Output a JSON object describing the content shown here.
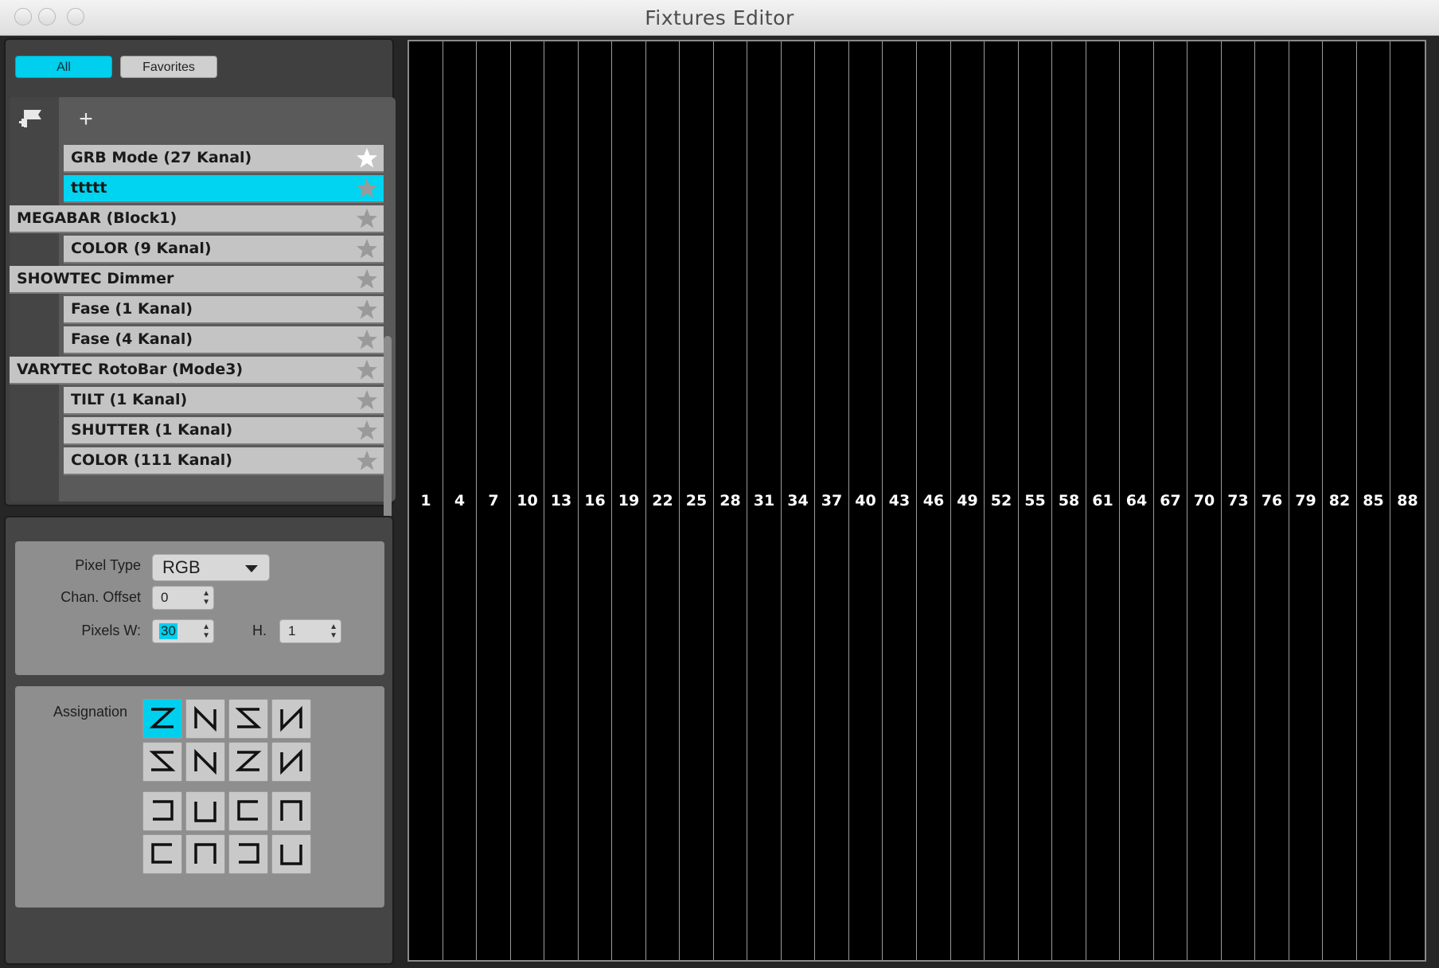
{
  "window": {
    "title": "Fixtures Editor"
  },
  "filters": {
    "all_label": "All",
    "favorites_label": "Favorites"
  },
  "fixtures": [
    {
      "label": "GRB Mode (27 Kanal)",
      "level": 1,
      "selected": false,
      "star": "bright"
    },
    {
      "label": "ttttt",
      "level": 1,
      "selected": true,
      "star": "dim"
    },
    {
      "label": "MEGABAR (Block1)",
      "level": 0,
      "selected": false,
      "star": "dim"
    },
    {
      "label": "COLOR (9 Kanal)",
      "level": 1,
      "selected": false,
      "star": "dim"
    },
    {
      "label": "SHOWTEC Dimmer",
      "level": 0,
      "selected": false,
      "star": "dim"
    },
    {
      "label": "Fase (1 Kanal)",
      "level": 1,
      "selected": false,
      "star": "dim"
    },
    {
      "label": "Fase (4 Kanal)",
      "level": 1,
      "selected": false,
      "star": "dim"
    },
    {
      "label": "VARYTEC RotoBar (Mode3)",
      "level": 0,
      "selected": false,
      "star": "dim"
    },
    {
      "label": "TILT (1 Kanal)",
      "level": 1,
      "selected": false,
      "star": "dim"
    },
    {
      "label": "SHUTTER (1 Kanal)",
      "level": 1,
      "selected": false,
      "star": "dim"
    },
    {
      "label": "COLOR (111 Kanal)",
      "level": 1,
      "selected": false,
      "star": "dim"
    }
  ],
  "properties": {
    "pixel_type_label": "Pixel Type",
    "pixel_type_value": "RGB",
    "chan_offset_label": "Chan. Offset",
    "chan_offset_value": "0",
    "pixels_w_label": "Pixels W:",
    "pixels_w_value": "30",
    "h_label": "H.",
    "h_value": "1"
  },
  "assignation": {
    "label": "Assignation",
    "selected_index": 0,
    "patterns": [
      "z-right",
      "n-down",
      "z-left",
      "n-up",
      "s-left",
      "n-mirror-up",
      "s-right",
      "n-mirror-down",
      "snake-left",
      "u-down",
      "snake-right",
      "n-arch-down",
      "snake-left-b",
      "arch-down",
      "snake-right-b",
      "u-up"
    ]
  },
  "channel_grid": {
    "columns": [
      "1",
      "4",
      "7",
      "10",
      "13",
      "16",
      "19",
      "22",
      "25",
      "28",
      "31",
      "34",
      "37",
      "40",
      "43",
      "46",
      "49",
      "52",
      "55",
      "58",
      "61",
      "64",
      "67",
      "70",
      "73",
      "76",
      "79",
      "82",
      "85",
      "88"
    ]
  },
  "colors": {
    "accent": "#00cfee",
    "row": "#c4c4c4",
    "grid_bg": "#000000"
  }
}
